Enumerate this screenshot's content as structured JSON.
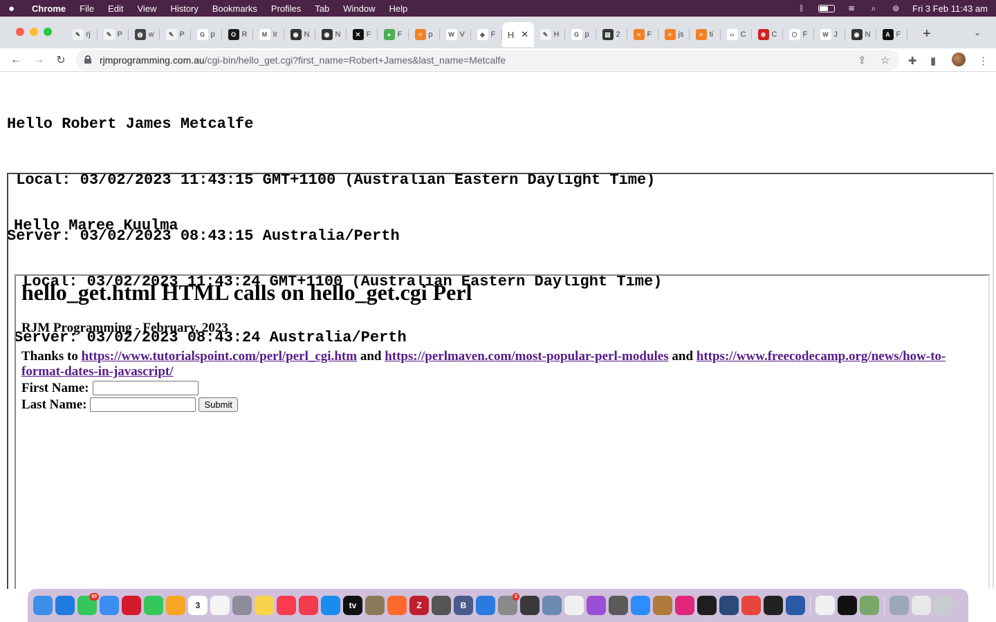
{
  "menubar": {
    "app": "Chrome",
    "items": [
      "File",
      "Edit",
      "View",
      "History",
      "Bookmarks",
      "Profiles",
      "Tab",
      "Window",
      "Help"
    ],
    "clock": "Fri 3 Feb  11:43 am"
  },
  "tabs": [
    {
      "letter": "rj",
      "color": "#f3f3f3",
      "glyph": "✎",
      "icon": "feather-icon"
    },
    {
      "letter": "P",
      "color": "#f3f3f3",
      "glyph": "✎",
      "icon": "feather-icon"
    },
    {
      "letter": "w",
      "color": "#444444",
      "glyph": "◍",
      "icon": "globe-icon"
    },
    {
      "letter": "P",
      "color": "#f3f3f3",
      "glyph": "✎",
      "icon": "feather-icon"
    },
    {
      "letter": "p",
      "color": "#ffffff",
      "glyph": "G",
      "icon": "google-icon"
    },
    {
      "letter": "R",
      "color": "#1a1a1a",
      "glyph": "O",
      "icon": "app-icon"
    },
    {
      "letter": "Ir",
      "color": "#ffffff",
      "glyph": "M",
      "icon": "gmail-icon"
    },
    {
      "letter": "N",
      "color": "#333333",
      "glyph": "◉",
      "icon": "openai-icon"
    },
    {
      "letter": "N",
      "color": "#333333",
      "glyph": "◉",
      "icon": "openai-icon"
    },
    {
      "letter": "F",
      "color": "#111111",
      "glyph": "✕",
      "icon": "x-icon"
    },
    {
      "letter": "F",
      "color": "#4caf50",
      "glyph": "●",
      "icon": "leaf-icon"
    },
    {
      "letter": "p",
      "color": "#f48024",
      "glyph": "≡",
      "icon": "stackoverflow-icon"
    },
    {
      "letter": "V",
      "color": "#ffffff",
      "glyph": "W",
      "icon": "w-icon"
    },
    {
      "letter": "F",
      "color": "#ffffff",
      "glyph": "◈",
      "icon": "diamond-icon"
    },
    {
      "letter": "H",
      "color": "#ffffff",
      "glyph": "",
      "icon": "page-icon",
      "active": true
    },
    {
      "letter": "H",
      "color": "#f3f3f3",
      "glyph": "✎",
      "icon": "feather-icon"
    },
    {
      "letter": "p",
      "color": "#ffffff",
      "glyph": "G",
      "icon": "google-icon"
    },
    {
      "letter": "2",
      "color": "#333333",
      "glyph": "▤",
      "icon": "image-icon"
    },
    {
      "letter": "F",
      "color": "#f48024",
      "glyph": "≡",
      "icon": "stackoverflow-icon"
    },
    {
      "letter": "js",
      "color": "#f48024",
      "glyph": "≡",
      "icon": "stackoverflow-icon"
    },
    {
      "letter": "ti",
      "color": "#f48024",
      "glyph": "≡",
      "icon": "stackoverflow-icon"
    },
    {
      "letter": "C",
      "color": "#ffffff",
      "glyph": "‹›",
      "icon": "code-icon"
    },
    {
      "letter": "C",
      "color": "#cc2222",
      "glyph": "⊕",
      "icon": "target-icon"
    },
    {
      "letter": "F",
      "color": "#ffffff",
      "glyph": "⬡",
      "icon": "hexagon-icon"
    },
    {
      "letter": "J",
      "color": "#ffffff",
      "glyph": "W",
      "icon": "w-icon"
    },
    {
      "letter": "N",
      "color": "#333333",
      "glyph": "◉",
      "icon": "openai-icon"
    },
    {
      "letter": "F",
      "color": "#111111",
      "glyph": "A",
      "icon": "a-icon"
    }
  ],
  "address": {
    "host": "rjmprogramming.com.au",
    "path": "/cgi-bin/hello_get.cgi?first_name=Robert+James&last_name=Metcalfe"
  },
  "page": {
    "lines1": [
      "Hello Robert James Metcalfe",
      " Local: 03/02/2023 11:43:15 GMT+1100 (Australian Eastern Daylight Time)",
      "Server: 03/02/2023 08:43:15 Australia/Perth"
    ],
    "lines2": [
      "Hello Maree Kuulma",
      " Local: 03/02/2023 11:43:24 GMT+1100 (Australian Eastern Daylight Time)",
      "Server: 03/02/2023 08:43:24 Australia/Perth"
    ],
    "heading": "hello_get.html HTML calls on hello_get.cgi Perl",
    "subheading": "RJM Programming - February, 2023",
    "thanks_prefix": "Thanks to ",
    "link1": "https://www.tutorialspoint.com/perl/perl_cgi.htm",
    "and1": " and ",
    "link2": "https://perlmaven.com/most-popular-perl-modules",
    "and2": " and ",
    "link3": "https://www.freecodecamp.org/news/how-to-format-dates-in-javascript/",
    "first_label": "First Name:",
    "first_value": "",
    "last_label": "Last Name:",
    "last_value": "",
    "submit": "Submit"
  },
  "dock": [
    {
      "name": "finder-icon",
      "color": "#3b8fe8"
    },
    {
      "name": "safari-icon",
      "color": "#1e7be0"
    },
    {
      "name": "messages-icon",
      "color": "#35c759",
      "badge": "93"
    },
    {
      "name": "mail-icon",
      "color": "#3c8ef3"
    },
    {
      "name": "opera-icon",
      "color": "#d41b2c"
    },
    {
      "name": "facetime-icon",
      "color": "#34c759"
    },
    {
      "name": "photos-icon",
      "color": "#f6a623"
    },
    {
      "name": "calendar-icon",
      "color": "#ffffff",
      "text": "3"
    },
    {
      "name": "reminders-icon",
      "color": "#f4f4f4"
    },
    {
      "name": "launchpad-icon",
      "color": "#8c8c9c"
    },
    {
      "name": "notes-icon",
      "color": "#f7d44c"
    },
    {
      "name": "music-icon",
      "color": "#fa3b50"
    },
    {
      "name": "news-icon",
      "color": "#f43a4f"
    },
    {
      "name": "appstore-icon",
      "color": "#1a8cf0"
    },
    {
      "name": "appletv-icon",
      "color": "#111111",
      "text": "tv"
    },
    {
      "name": "gimp-icon",
      "color": "#8a7a5a"
    },
    {
      "name": "firefox-icon",
      "color": "#ff6a2b"
    },
    {
      "name": "filezilla-icon",
      "color": "#bf1e2d",
      "text": "Z"
    },
    {
      "name": "calculator-icon",
      "color": "#555555"
    },
    {
      "name": "bbedit-icon",
      "color": "#4a5a8a",
      "text": "B"
    },
    {
      "name": "xcode-icon",
      "color": "#2a7ae0"
    },
    {
      "name": "settings-icon",
      "color": "#8a8a8a",
      "badge": "2"
    },
    {
      "name": "elephant-icon",
      "color": "#3a3a3a"
    },
    {
      "name": "preview-icon",
      "color": "#6a8ab0"
    },
    {
      "name": "document-icon",
      "color": "#f0f0f0"
    },
    {
      "name": "podcasts-icon",
      "color": "#9b4fd6"
    },
    {
      "name": "gimp-wilber-icon",
      "color": "#5a5a5a"
    },
    {
      "name": "zoom-icon",
      "color": "#2d8cff"
    },
    {
      "name": "books-icon",
      "color": "#b07a3a"
    },
    {
      "name": "intellij-icon",
      "color": "#e0287a"
    },
    {
      "name": "terminal-icon",
      "color": "#1e1e1e"
    },
    {
      "name": "quicktime-icon",
      "color": "#2a4a7a"
    },
    {
      "name": "chrome-icon",
      "color": "#e8453c"
    },
    {
      "name": "inkscape-icon",
      "color": "#222222"
    },
    {
      "name": "affinity-icon",
      "color": "#2a5aa8"
    },
    {
      "sep": true
    },
    {
      "name": "textedit-icon",
      "color": "#f0f0f0"
    },
    {
      "name": "terminal-icon",
      "color": "#111111"
    },
    {
      "name": "preview-app-icon",
      "color": "#7aa86a"
    },
    {
      "sep": true
    },
    {
      "name": "downloads-folder-icon",
      "color": "#9aa8b8"
    },
    {
      "name": "files-stack-icon",
      "color": "#e8e8e8"
    },
    {
      "name": "trash-icon",
      "color": "#c8ccd0"
    }
  ]
}
